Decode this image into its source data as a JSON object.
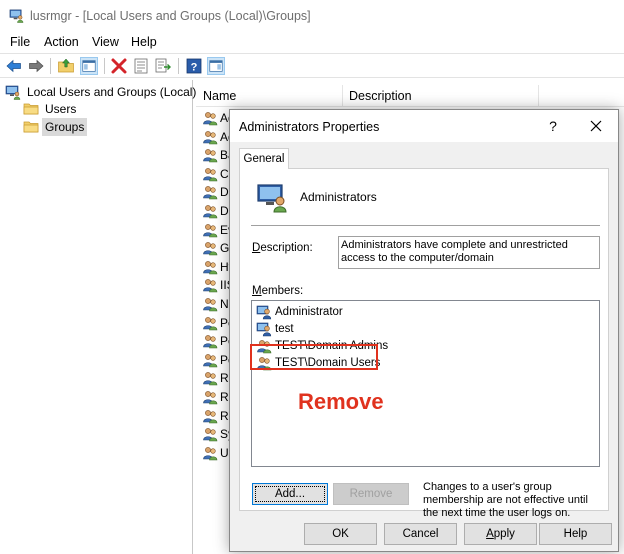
{
  "window": {
    "title": "lusrmgr - [Local Users and Groups (Local)\\Groups]",
    "icon": "lusrmgr-icon"
  },
  "menu": [
    "File",
    "Action",
    "View",
    "Help"
  ],
  "toolbar": {
    "buttons": [
      "back-icon",
      "forward-icon",
      "up-folder-icon",
      "show-hide-tree-icon",
      "delete-icon",
      "properties-icon",
      "export-list-icon",
      "help-icon",
      "action-pane-icon"
    ]
  },
  "tree": {
    "root": "Local Users and Groups (Local)",
    "children": [
      {
        "label": "Users",
        "selected": false
      },
      {
        "label": "Groups",
        "selected": true
      }
    ]
  },
  "list": {
    "columns": [
      "Name",
      "Description"
    ],
    "rows": [
      "Ad",
      "Ad",
      "Ba",
      "Cr",
      "De",
      "Dis",
      "Ev",
      "Gu",
      "Hy",
      "IIS",
      "Ne",
      "Pe",
      "Pe",
      "Po",
      "Re",
      "Re",
      "Re",
      "Sy",
      "Us"
    ]
  },
  "dialog": {
    "title": "Administrators Properties",
    "help": "?",
    "close": "✕",
    "tab": "General",
    "group_name": "Administrators",
    "description_label": "Description:",
    "description_value": "Administrators have complete and unrestricted access to the computer/domain",
    "members_label": "Members:",
    "members": [
      {
        "name": "Administrator",
        "type": "user"
      },
      {
        "name": "test",
        "type": "user"
      },
      {
        "name": "TEST\\Domain Admins",
        "type": "group"
      },
      {
        "name": "TEST\\Domain Users",
        "type": "group"
      }
    ],
    "add_label": "Add...",
    "remove_label": "Remove",
    "note": "Changes to a user's group membership are not effective until the next time the user logs on.",
    "ok_label": "OK",
    "cancel_label": "Cancel",
    "apply_label": "Apply",
    "help_label": "Help"
  },
  "annotation": {
    "text": "Remove",
    "color": "#e0321e"
  }
}
